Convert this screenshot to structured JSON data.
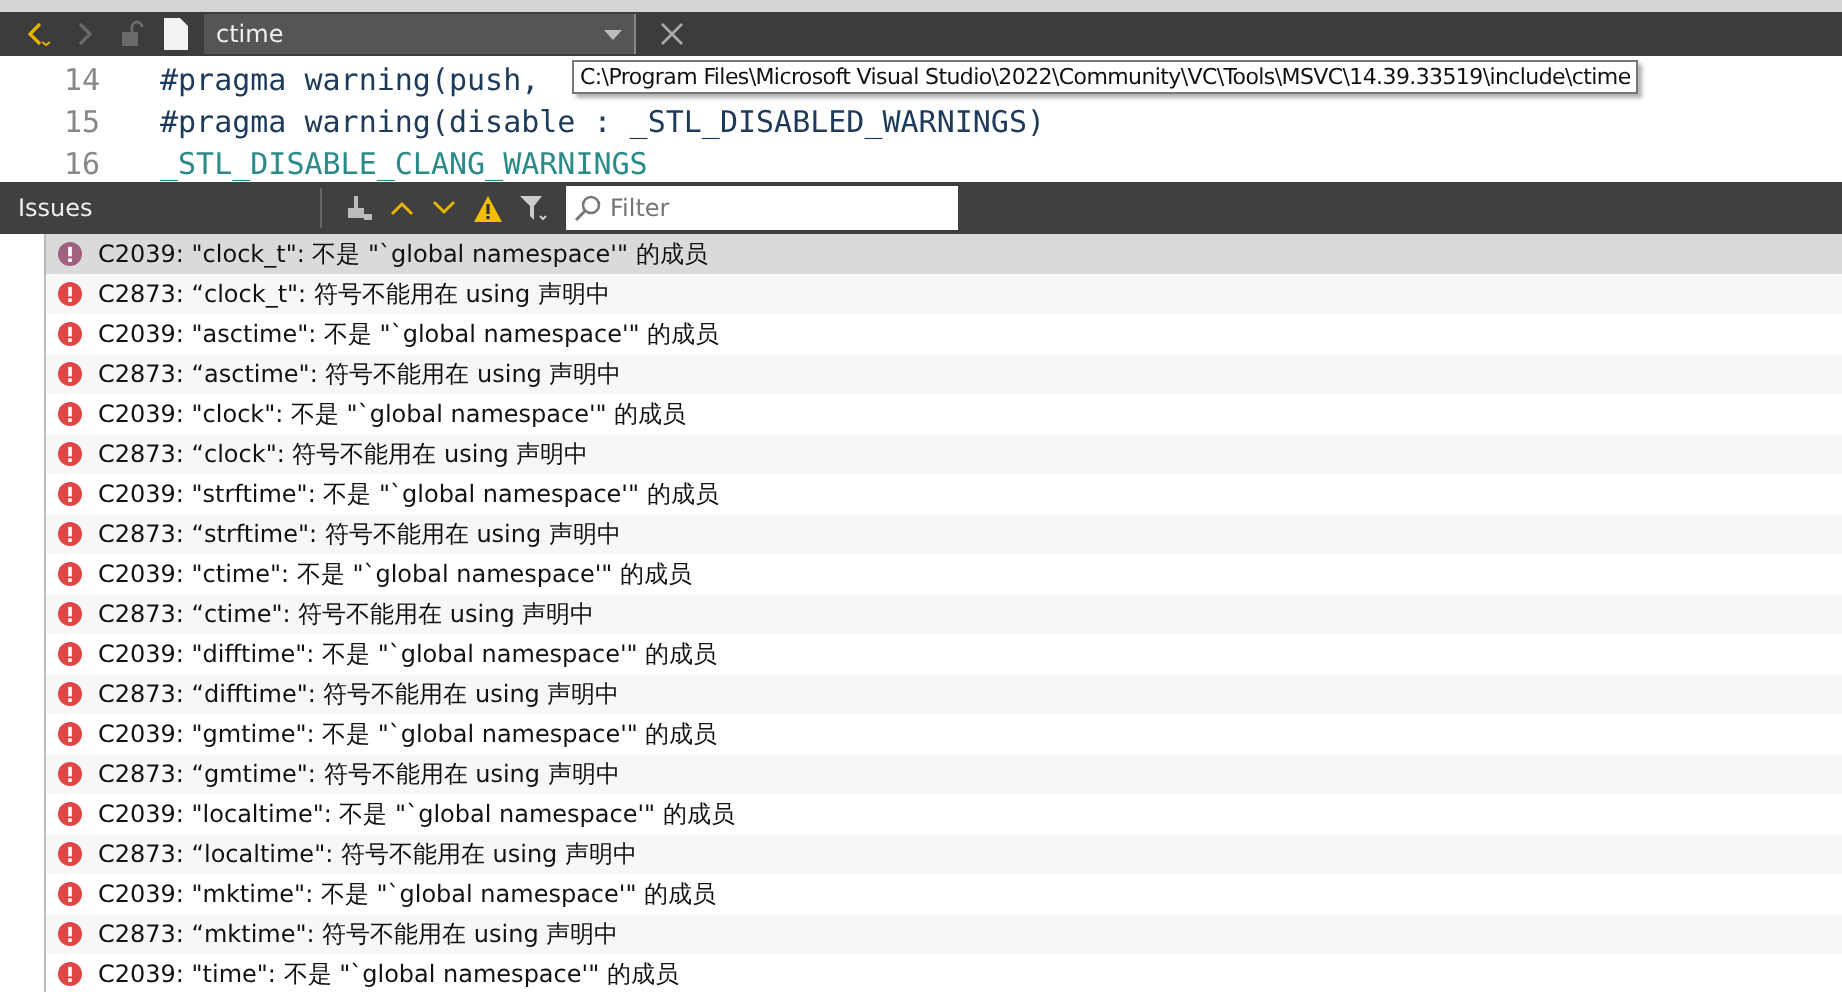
{
  "toolbar": {
    "file_name": "ctime"
  },
  "editor": {
    "lines": [
      {
        "number": "14",
        "text": "#pragma warning(push,",
        "kind": "directive"
      },
      {
        "number": "15",
        "text": "#pragma warning(disable : _STL_DISABLED_WARNINGS)",
        "kind": "directive"
      },
      {
        "number": "16",
        "text": "_STL_DISABLE_CLANG_WARNINGS",
        "kind": "macro"
      }
    ],
    "tooltip": "C:\\Program Files\\Microsoft Visual Studio\\2022\\Community\\VC\\Tools\\MSVC\\14.39.33519\\include\\ctime"
  },
  "issues": {
    "title": "Issues",
    "filter": {
      "placeholder": "Filter"
    },
    "rows": [
      {
        "text": "C2039: \"clock_t\": 不是 \"`global namespace'\" 的成员",
        "selected": true
      },
      {
        "text": "C2873: “clock_t\": 符号不能用在 using 声明中",
        "selected": false
      },
      {
        "text": "C2039: \"asctime\": 不是 \"`global namespace'\" 的成员",
        "selected": false
      },
      {
        "text": "C2873: “asctime\": 符号不能用在 using 声明中",
        "selected": false
      },
      {
        "text": "C2039: \"clock\": 不是 \"`global namespace'\" 的成员",
        "selected": false
      },
      {
        "text": "C2873: “clock\": 符号不能用在 using 声明中",
        "selected": false
      },
      {
        "text": "C2039: \"strftime\": 不是 \"`global namespace'\" 的成员",
        "selected": false
      },
      {
        "text": "C2873: “strftime\": 符号不能用在 using 声明中",
        "selected": false
      },
      {
        "text": "C2039: \"ctime\": 不是 \"`global namespace'\" 的成员",
        "selected": false
      },
      {
        "text": "C2873: “ctime\": 符号不能用在 using 声明中",
        "selected": false
      },
      {
        "text": "C2039: \"difftime\": 不是 \"`global namespace'\" 的成员",
        "selected": false
      },
      {
        "text": "C2873: “difftime\": 符号不能用在 using 声明中",
        "selected": false
      },
      {
        "text": "C2039: \"gmtime\": 不是 \"`global namespace'\" 的成员",
        "selected": false
      },
      {
        "text": "C2873: “gmtime\": 符号不能用在 using 声明中",
        "selected": false
      },
      {
        "text": "C2039: \"localtime\": 不是 \"`global namespace'\" 的成员",
        "selected": false
      },
      {
        "text": "C2873: “localtime\": 符号不能用在 using 声明中",
        "selected": false
      },
      {
        "text": "C2039: \"mktime\": 不是 \"`global namespace'\" 的成员",
        "selected": false
      },
      {
        "text": "C2873: “mktime\": 符号不能用在 using 声明中",
        "selected": false
      },
      {
        "text": "C2039: \"time\": 不是 \"`global namespace'\" 的成员",
        "selected": false
      }
    ]
  }
}
